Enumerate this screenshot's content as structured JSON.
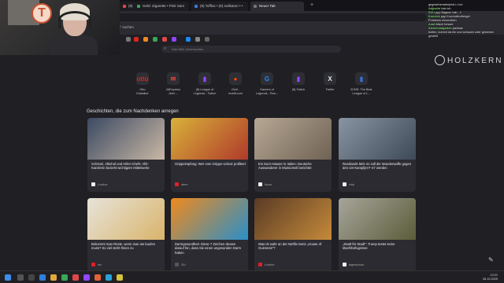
{
  "tabs": [
    {
      "label": "(9) Eigentl. • Pink Sam",
      "color": "#e0474c"
    },
    {
      "label": "Geld: Zigarette • Pink Sam",
      "color": "#3aa657"
    },
    {
      "label": "(9) Tofflos • (8) Indikatori • •",
      "color": "#3c78d8"
    },
    {
      "label": "Neuer Tab",
      "color": "#777",
      "active": true
    }
  ],
  "new_tab_glyph": "+",
  "search": {
    "placeholder": "Das Web durchsuchen"
  },
  "address_hint": "age\" suchen",
  "brand": "HOLZKERN",
  "chat": [
    {
      "user": "",
      "text": "gegesehenaberjetzt.i.r.ine"
    },
    {
      "user": "Adjustin",
      "text": "hab ich"
    },
    {
      "user": "SUU",
      "text": "ppp Bagsoc hab - 1"
    },
    {
      "user": "Konvick",
      "text": "ppp Konvicklindbeigel"
    },
    {
      "user": "",
      "text": "Problems einsichtlich"
    },
    {
      "user": "Anal",
      "text": "Alsich besser"
    },
    {
      "user": "Alchemistgarten",
      "text": "jaetwas"
    },
    {
      "user": "",
      "text": "bolten, kommt da ein und schauen oder gewesen"
    },
    {
      "user": "",
      "text": "gestellt"
    }
  ],
  "shortcuts": [
    {
      "label": "Otto\nKlassiker",
      "glyph": "otto",
      "color": "#e2231a"
    },
    {
      "label": "AliExpress\nJetzt ...",
      "glyph": "✉",
      "color": "#e0443c"
    },
    {
      "label": "(8) League of\nLegends - Twitch",
      "glyph": "▮",
      "color": "#9146ff"
    },
    {
      "label": "Geiri -\nreddit.com",
      "glyph": "●",
      "color": "#ff4500"
    },
    {
      "label": "Gamers of\nLegends - Ran...",
      "glyph": "G",
      "color": "#1a8cff"
    },
    {
      "label": "(8) Twitch",
      "glyph": "▮",
      "color": "#9146ff"
    },
    {
      "label": "Twitter",
      "glyph": "X",
      "color": "#e8e8e8"
    },
    {
      "label": "B BIS: The Best\nLeague of L...",
      "glyph": "▮",
      "color": "#3a6fd8"
    }
  ],
  "section_title": "Geschichten, die zum Nachdenken anregen",
  "cards": [
    {
      "title": "Schönel, Alkohol und Hitler-Chefs: AfD-Kanzlerin bezieht wichtigere Mittelwerte",
      "source": "t-online",
      "img": [
        "#3b4a63",
        "#c9b7a4"
      ],
      "srccolor": "#eee"
    },
    {
      "title": "Grippeimpfung: Wer vom Grippe-schutz profitiert",
      "source": "stern",
      "img": [
        "#d8b13a",
        "#b03a2a"
      ],
      "srccolor": "#e21f26"
    },
    {
      "title": "Ein Euro-Häuser in Italien: Deutsche Auswanderer in Mussomeli berichtet",
      "source": "focus",
      "img": [
        "#b7a894",
        "#6f6254"
      ],
      "srccolor": "#eee"
    },
    {
      "title": "Russlands MiG-41 soll die Wunderwaffe gegen den US-Kampfjet F-47 werden",
      "source": "chip",
      "img": [
        "#8895a3",
        "#3e4957"
      ],
      "srccolor": "#eee"
    },
    {
      "title": "Bekommt man Reste, wenn man sie kaufen muss? So viel steht Ihnen zu",
      "source": "ntv",
      "img": [
        "#e7e3da",
        "#d9b46a"
      ],
      "srccolor": "#e21f26"
    },
    {
      "title": "Darmgesundheit: Diese 7 Zeichen deuten darauf hin, dass Sie einen ungesunden Darm haben",
      "source": "GU",
      "img": [
        "#f08a1c",
        "#2a8fc9"
      ],
      "srccolor": "#555"
    },
    {
      "title": "Was ist wahr an der Netflix-Serie „House of Guinness\"?",
      "source": "t-online",
      "img": [
        "#5a3b25",
        "#c58a3a"
      ],
      "srccolor": "#e21f26"
    },
    {
      "title": "„Stadt für Stadt\": Trump testet seine Machtbefugnisse",
      "source": "tagesschau",
      "img": [
        "#a7a59a",
        "#5a5d3a"
      ],
      "srccolor": "#eee"
    }
  ],
  "tray": {
    "time": "13:21",
    "date": "26.10.2025"
  }
}
